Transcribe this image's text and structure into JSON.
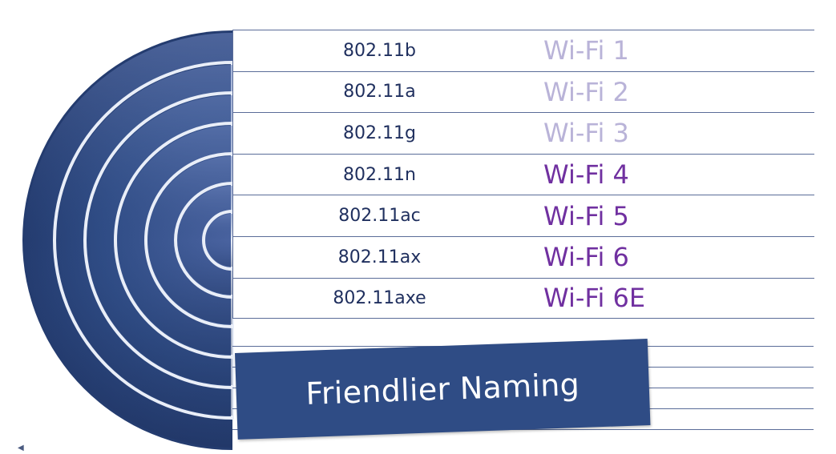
{
  "rows": [
    {
      "standard": "802.11b",
      "name": "Wi-Fi 1",
      "legacy": true
    },
    {
      "standard": "802.11a",
      "name": "Wi-Fi 2",
      "legacy": true
    },
    {
      "standard": "802.11g",
      "name": "Wi-Fi 3",
      "legacy": true
    },
    {
      "standard": "802.11n",
      "name": "Wi-Fi 4",
      "legacy": false
    },
    {
      "standard": "802.11ac",
      "name": "Wi-Fi 5",
      "legacy": false
    },
    {
      "standard": "802.11ax",
      "name": "Wi-Fi 6",
      "legacy": false
    },
    {
      "standard": "802.11axe",
      "name": "Wi-Fi 6E",
      "legacy": false
    }
  ],
  "banner": {
    "text": "Friendlier Naming"
  },
  "colors": {
    "arc_fill": "#2f4c85",
    "legacy_text": "#b9b3d8",
    "new_text": "#7030a0",
    "standard_text": "#1f2f5e",
    "grid_line": "#5a6c98"
  }
}
